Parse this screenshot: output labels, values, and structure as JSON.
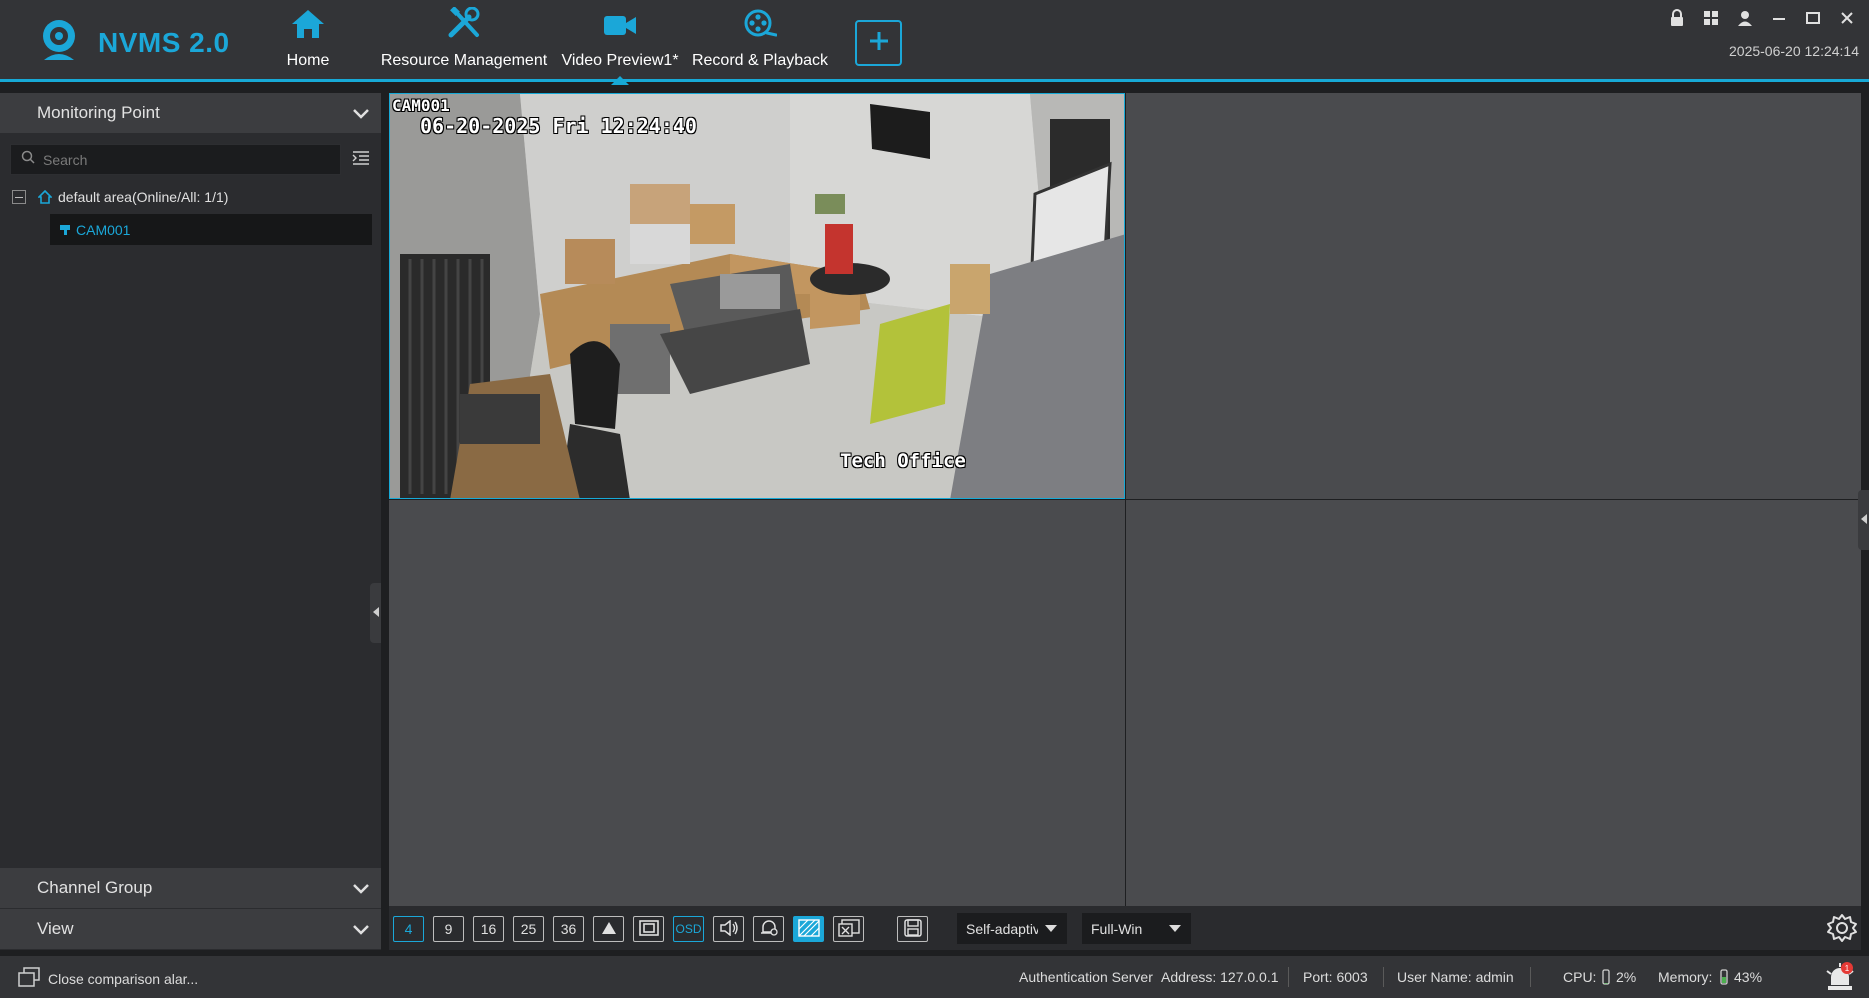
{
  "app": {
    "title": "NVMS 2.0",
    "datetime": "2025-06-20 12:24:14"
  },
  "nav": {
    "tabs": [
      {
        "label": "Home",
        "icon": "home-icon"
      },
      {
        "label": "Resource Management",
        "icon": "tools-icon"
      },
      {
        "label": "Video Preview1*",
        "icon": "video-camera-icon",
        "active": true
      },
      {
        "label": "Record & Playback",
        "icon": "film-reel-icon"
      }
    ],
    "add_tab_icon": "plus-icon"
  },
  "window_controls": [
    "lock-icon",
    "layout-icon",
    "user-icon",
    "minimize-icon",
    "maximize-icon",
    "close-icon"
  ],
  "sidebar": {
    "monitoring_point": "Monitoring Point",
    "search_placeholder": "Search",
    "tree_root": "default area(Online/All: 1/1)",
    "camera": "CAM001",
    "channel_group": "Channel Group",
    "view": "View"
  },
  "video": {
    "channel_name": "CAM001",
    "timestamp": "06-20-2025 Fri 12:24:40",
    "location": "Tech Office"
  },
  "toolbar": {
    "layouts": [
      "4",
      "9",
      "16",
      "25",
      "36"
    ],
    "selected_layout": "4",
    "osd_label": "OSD",
    "scale_mode": "Self-adaptive",
    "window_mode": "Full-Win"
  },
  "status": {
    "message": "Close comparison alar...",
    "auth_server": "Authentication Server",
    "address": "Address: 127.0.0.1",
    "port": "Port: 6003",
    "user": "User Name: admin",
    "cpu_label": "CPU:",
    "cpu_value": "2%",
    "memory_label": "Memory:",
    "memory_value": "43%",
    "alarm_count": "1"
  },
  "colors": {
    "accent": "#1ba7d8",
    "background": "#1e1f21",
    "panel": "#2b2c2f",
    "empty_cell": "#4a4b4e"
  }
}
